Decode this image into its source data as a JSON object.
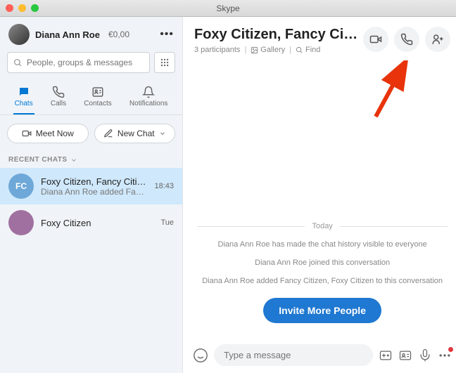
{
  "window": {
    "title": "Skype"
  },
  "user": {
    "name": "Diana Ann Roe",
    "balance": "€0,00"
  },
  "search": {
    "placeholder": "People, groups & messages"
  },
  "tabs": {
    "chats": "Chats",
    "calls": "Calls",
    "contacts": "Contacts",
    "notifications": "Notifications"
  },
  "actions": {
    "meet": "Meet Now",
    "newchat": "New Chat"
  },
  "recent": {
    "header": "RECENT CHATS",
    "items": [
      {
        "avatar_initials": "FC",
        "avatar_bg": "#6ea8d8",
        "title": "Foxy Citizen, Fancy Citizen",
        "subtitle": "Diana Ann Roe added Fancy …",
        "time": "18:43",
        "selected": true
      },
      {
        "avatar_initials": "",
        "avatar_bg": "#a070a0",
        "title": "Foxy Citizen",
        "subtitle": "",
        "time": "Tue",
        "selected": false
      }
    ]
  },
  "conversation": {
    "title": "Foxy Citizen, Fancy Ci…",
    "participants": "3 participants",
    "gallery": "Gallery",
    "find": "Find",
    "day": "Today",
    "messages": [
      "Diana Ann Roe has made the chat history visible to everyone",
      "Diana Ann Roe joined this conversation",
      "Diana Ann Roe added Fancy Citizen, Foxy Citizen to this conversation"
    ],
    "invite": "Invite More People"
  },
  "composer": {
    "placeholder": "Type a message"
  }
}
